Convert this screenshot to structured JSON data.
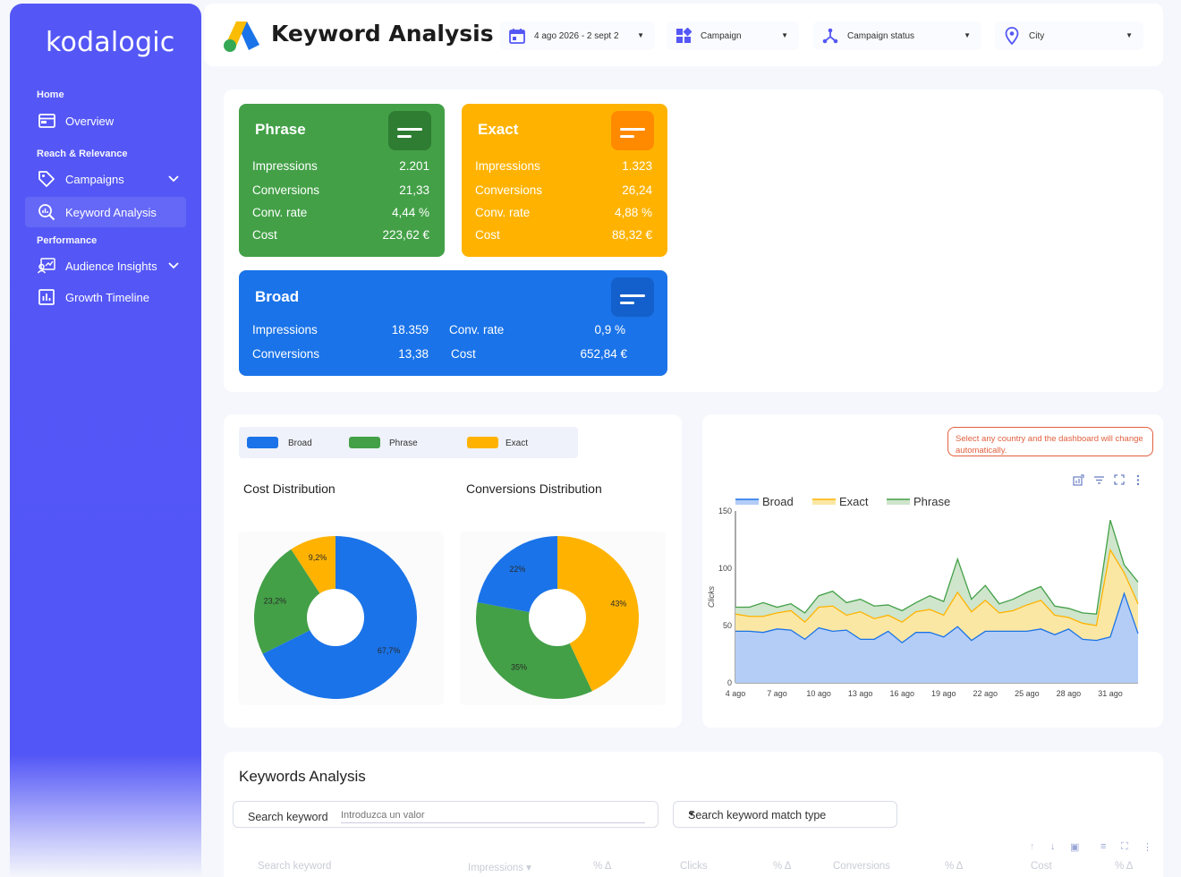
{
  "brand": "kodalogic",
  "sidebar": {
    "sections": [
      {
        "label": "Home"
      },
      {
        "label": "Reach & Relevance"
      },
      {
        "label": "Performance"
      }
    ],
    "items": [
      {
        "label": "Overview",
        "icon": "overview-icon"
      },
      {
        "label": "Campaigns",
        "icon": "tag-icon"
      },
      {
        "label": "Keyword Analysis",
        "icon": "search-analytics-icon",
        "active": true
      },
      {
        "label": "Audience Insights",
        "icon": "audience-icon"
      },
      {
        "label": "Growth Timeline",
        "icon": "bar-chart-icon"
      }
    ]
  },
  "header": {
    "title": "Keyword Analysis",
    "filters": {
      "date": "4 ago 2026 - 2 sept 2",
      "campaign": "Campaign",
      "status": "Campaign status",
      "city": "City"
    }
  },
  "cards": {
    "phrase": {
      "title": "Phrase",
      "color": "#43a047",
      "rows": [
        [
          "Impressions",
          "2.201"
        ],
        [
          "Conversions",
          "21,33"
        ],
        [
          "Conv. rate",
          "4,44 %"
        ],
        [
          "Cost",
          "223,62 €"
        ]
      ]
    },
    "exact": {
      "title": "Exact",
      "color": "#ffb300",
      "rows": [
        [
          "Impressions",
          "1.323"
        ],
        [
          "Conversions",
          "26,24"
        ],
        [
          "Conv. rate",
          "4,88 %"
        ],
        [
          "Cost",
          "88,32 €"
        ]
      ]
    },
    "broad": {
      "title": "Broad",
      "color": "#1a73e8",
      "rows": [
        [
          "Impressions",
          "18.359"
        ],
        [
          "Conversions",
          "13,38"
        ],
        [
          "Conv. rate",
          "0,9 %"
        ],
        [
          "Cost",
          "652,84 €"
        ]
      ]
    }
  },
  "legend": [
    {
      "label": "Broad",
      "color": "#1a73e8"
    },
    {
      "label": "Phrase",
      "color": "#43a047"
    },
    {
      "label": "Exact",
      "color": "#ffb300"
    }
  ],
  "note": "Select any country and the dashboard will change automatically.",
  "keywords": {
    "title": "Keywords Analysis",
    "search_label": "Search keyword",
    "search_placeholder": "Introduzca un valor",
    "match_type_label": "Search keyword match type",
    "columns": [
      "Search keyword",
      "Impressions ▾",
      "% Δ",
      "Clicks",
      "% Δ",
      "Conversions",
      "% Δ",
      "Cost",
      "% Δ"
    ]
  },
  "chart_data": [
    {
      "type": "pie",
      "title": "Cost Distribution",
      "labels": [
        "Broad",
        "Phrase",
        "Exact"
      ],
      "values": [
        67.7,
        23.2,
        9.2
      ],
      "value_labels": [
        "67,7%",
        "23,2%",
        "9,2%"
      ],
      "colors": [
        "#1a73e8",
        "#43a047",
        "#ffb300"
      ],
      "donut": true
    },
    {
      "type": "pie",
      "title": "Conversions Distribution",
      "labels": [
        "Exact",
        "Phrase",
        "Broad"
      ],
      "values": [
        43,
        35,
        22
      ],
      "value_labels": [
        "43%",
        "35%",
        "22%"
      ],
      "colors": [
        "#ffb300",
        "#43a047",
        "#1a73e8"
      ],
      "donut": true
    },
    {
      "type": "area",
      "stacked": true,
      "ylabel": "Clicks",
      "ylim": [
        0,
        150
      ],
      "yticks": [
        0,
        50,
        100,
        150
      ],
      "x": [
        "4 ago",
        "5 ago",
        "6 ago",
        "7 ago",
        "8 ago",
        "9 ago",
        "10 ago",
        "11 ago",
        "12 ago",
        "13 ago",
        "14 ago",
        "15 ago",
        "16 ago",
        "17 ago",
        "18 ago",
        "19 ago",
        "20 ago",
        "21 ago",
        "22 ago",
        "23 ago",
        "24 ago",
        "25 ago",
        "26 ago",
        "27 ago",
        "28 ago",
        "29 ago",
        "30 ago",
        "31 ago",
        "1 sept",
        "2 sept"
      ],
      "xticks": [
        "4 ago",
        "7 ago",
        "10 ago",
        "13 ago",
        "16 ago",
        "19 ago",
        "22 ago",
        "25 ago",
        "28 ago",
        "31 ago"
      ],
      "series": [
        {
          "name": "Broad",
          "color": "#1a73e8",
          "fill": "#b4cdf6",
          "values": [
            45,
            45,
            44,
            47,
            46,
            38,
            48,
            45,
            46,
            38,
            38,
            45,
            35,
            44,
            44,
            40,
            49,
            37,
            45,
            45,
            45,
            45,
            47,
            42,
            47,
            38,
            37,
            40,
            78,
            43
          ]
        },
        {
          "name": "Exact",
          "color": "#ffb300",
          "fill": "#fbe7a4",
          "values": [
            15,
            13,
            14,
            14,
            17,
            15,
            18,
            22,
            13,
            24,
            18,
            14,
            18,
            18,
            20,
            19,
            30,
            25,
            27,
            16,
            18,
            23,
            25,
            17,
            10,
            14,
            13,
            76,
            18,
            26
          ]
        },
        {
          "name": "Phrase",
          "color": "#43a047",
          "fill": "#cfe5cc",
          "values": [
            6,
            8,
            12,
            5,
            6,
            8,
            10,
            13,
            11,
            11,
            11,
            9,
            10,
            8,
            12,
            12,
            29,
            11,
            13,
            8,
            10,
            11,
            12,
            8,
            8,
            9,
            10,
            26,
            7,
            19
          ]
        }
      ]
    }
  ]
}
